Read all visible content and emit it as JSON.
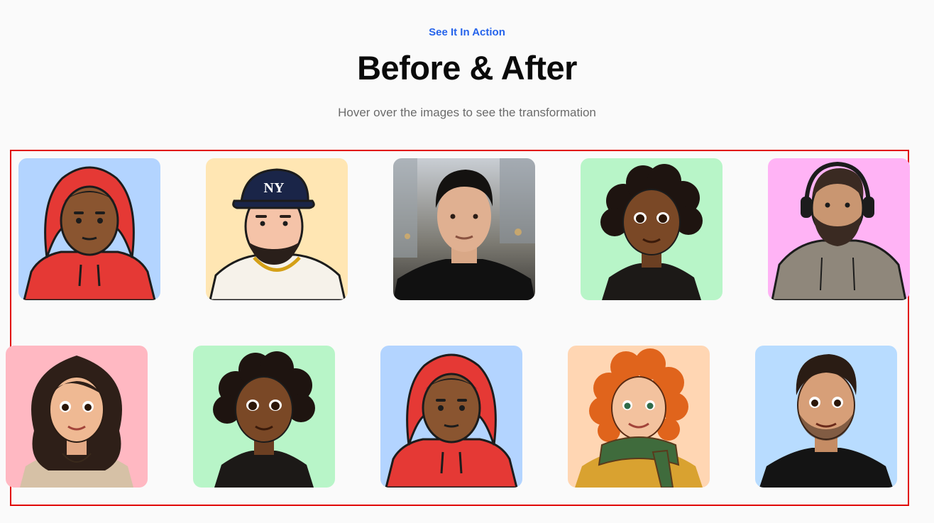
{
  "section": {
    "eyebrow": "See It In Action",
    "title": "Before & After",
    "subtitle": "Hover over the images to see the transformation"
  },
  "gallery": {
    "highlight_color": "#e10600",
    "cards": [
      {
        "avatar": "boy-red-hoodie-avatar",
        "background": "#b3d4ff"
      },
      {
        "avatar": "man-ny-cap-avatar",
        "background": "#ffe6b3"
      },
      {
        "avatar": "man-street-photo",
        "background": "#8a8f96"
      },
      {
        "avatar": "woman-curly-hair-avatar",
        "background": "#b8f5c8"
      },
      {
        "avatar": "man-headphones-avatar",
        "background": "#ffb3f5"
      },
      {
        "avatar": "woman-wavy-hair-avatar",
        "background": "#ffb8c2"
      },
      {
        "avatar": "woman-curly-hair-avatar",
        "background": "#b8f5c8"
      },
      {
        "avatar": "boy-red-hoodie-avatar",
        "background": "#b3d4ff"
      },
      {
        "avatar": "girl-red-curls-scarf-avatar",
        "background": "#ffd6b3"
      },
      {
        "avatar": "man-black-tee-avatar",
        "background": "#b8dcff"
      }
    ]
  }
}
